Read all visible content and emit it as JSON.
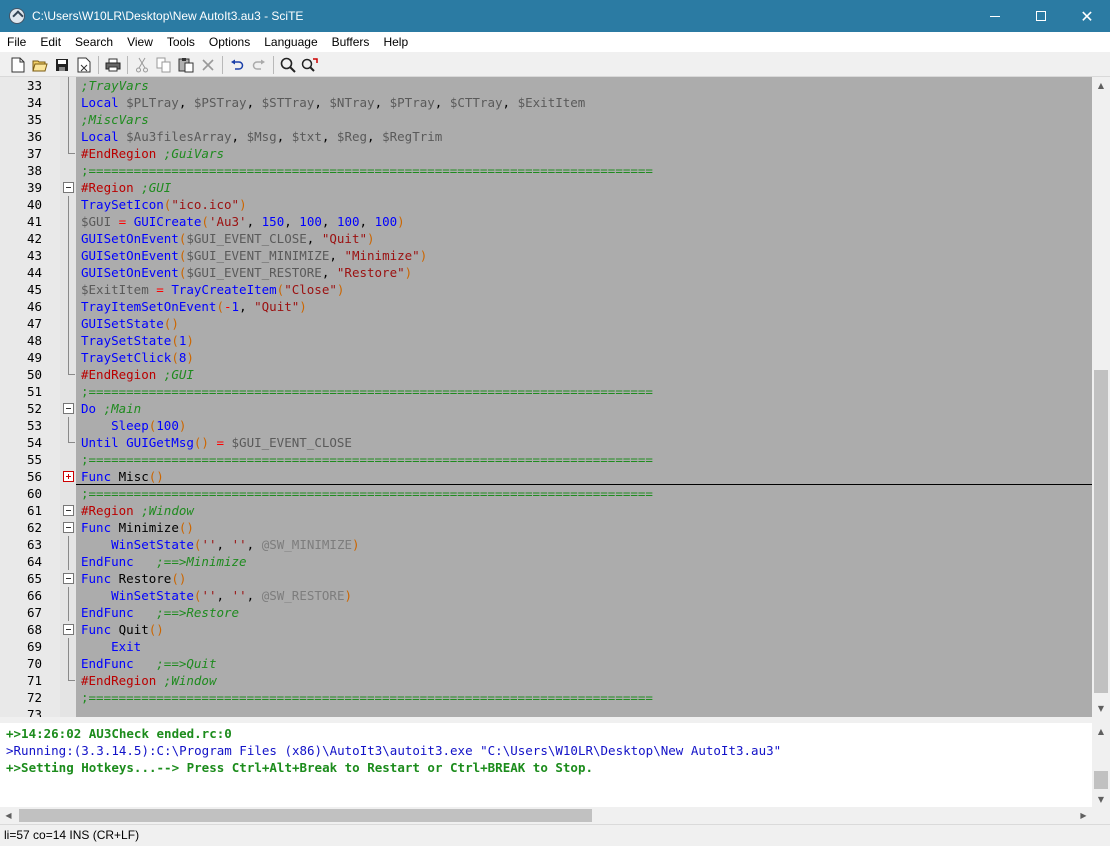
{
  "window": {
    "title": "C:\\Users\\W10LR\\Desktop\\New AutoIt3.au3 - SciTE",
    "minimize": "",
    "maximize": "",
    "close": "✕"
  },
  "menu": [
    "File",
    "Edit",
    "Search",
    "View",
    "Tools",
    "Options",
    "Language",
    "Buffers",
    "Help"
  ],
  "toolbar": {
    "icons": [
      "new-file-icon",
      "open-folder-icon",
      "save-icon",
      "close-file-icon",
      "print-icon",
      "cut-icon",
      "copy-icon",
      "paste-icon",
      "delete-icon",
      "undo-icon",
      "redo-icon",
      "find-icon",
      "find-replace-icon"
    ]
  },
  "editor": {
    "lines": [
      {
        "n": "33",
        "fold": "line",
        "tokens": [
          [
            "com",
            ";TrayVars"
          ]
        ]
      },
      {
        "n": "34",
        "fold": "line",
        "tokens": [
          [
            "kw",
            "Local "
          ],
          [
            "var",
            "$PLTray"
          ],
          [
            "txt",
            ", "
          ],
          [
            "var",
            "$PSTray"
          ],
          [
            "txt",
            ", "
          ],
          [
            "var",
            "$STTray"
          ],
          [
            "txt",
            ", "
          ],
          [
            "var",
            "$NTray"
          ],
          [
            "txt",
            ", "
          ],
          [
            "var",
            "$PTray"
          ],
          [
            "txt",
            ", "
          ],
          [
            "var",
            "$CTTray"
          ],
          [
            "txt",
            ", "
          ],
          [
            "var",
            "$ExitItem"
          ]
        ]
      },
      {
        "n": "35",
        "fold": "line",
        "tokens": [
          [
            "com",
            ";MiscVars"
          ]
        ]
      },
      {
        "n": "36",
        "fold": "line",
        "tokens": [
          [
            "kw",
            "Local "
          ],
          [
            "var",
            "$Au3filesArray"
          ],
          [
            "txt",
            ", "
          ],
          [
            "var",
            "$Msg"
          ],
          [
            "txt",
            ", "
          ],
          [
            "var",
            "$txt"
          ],
          [
            "txt",
            ", "
          ],
          [
            "var",
            "$Reg"
          ],
          [
            "txt",
            ", "
          ],
          [
            "var",
            "$RegTrim"
          ]
        ]
      },
      {
        "n": "37",
        "fold": "end",
        "tokens": [
          [
            "pre",
            "#EndRegion "
          ],
          [
            "com",
            ";GuiVars"
          ]
        ]
      },
      {
        "n": "38",
        "fold": "none",
        "tokens": [
          [
            "sep",
            ";==========================================================================="
          ]
        ]
      },
      {
        "n": "39",
        "fold": "minus",
        "tokens": [
          [
            "pre",
            "#Region "
          ],
          [
            "com",
            ";GUI"
          ]
        ]
      },
      {
        "n": "40",
        "fold": "line",
        "tokens": [
          [
            "fn",
            "TraySetIcon"
          ],
          [
            "par",
            "("
          ],
          [
            "str",
            "\"ico.ico\""
          ],
          [
            "par",
            ")"
          ]
        ]
      },
      {
        "n": "41",
        "fold": "line",
        "tokens": [
          [
            "var",
            "$GUI"
          ],
          [
            "op",
            " = "
          ],
          [
            "fn",
            "GUICreate"
          ],
          [
            "par",
            "("
          ],
          [
            "str",
            "'Au3'"
          ],
          [
            "txt",
            ", "
          ],
          [
            "num",
            "150"
          ],
          [
            "txt",
            ", "
          ],
          [
            "num",
            "100"
          ],
          [
            "txt",
            ", "
          ],
          [
            "num",
            "100"
          ],
          [
            "txt",
            ", "
          ],
          [
            "num",
            "100"
          ],
          [
            "par",
            ")"
          ]
        ]
      },
      {
        "n": "42",
        "fold": "line",
        "tokens": [
          [
            "fn",
            "GUISetOnEvent"
          ],
          [
            "par",
            "("
          ],
          [
            "var",
            "$GUI_EVENT_CLOSE"
          ],
          [
            "txt",
            ", "
          ],
          [
            "str",
            "\"Quit\""
          ],
          [
            "par",
            ")"
          ]
        ]
      },
      {
        "n": "43",
        "fold": "line",
        "tokens": [
          [
            "fn",
            "GUISetOnEvent"
          ],
          [
            "par",
            "("
          ],
          [
            "var",
            "$GUI_EVENT_MINIMIZE"
          ],
          [
            "txt",
            ", "
          ],
          [
            "str",
            "\"Minimize\""
          ],
          [
            "par",
            ")"
          ]
        ]
      },
      {
        "n": "44",
        "fold": "line",
        "tokens": [
          [
            "fn",
            "GUISetOnEvent"
          ],
          [
            "par",
            "("
          ],
          [
            "var",
            "$GUI_EVENT_RESTORE"
          ],
          [
            "txt",
            ", "
          ],
          [
            "str",
            "\"Restore\""
          ],
          [
            "par",
            ")"
          ]
        ]
      },
      {
        "n": "45",
        "fold": "line",
        "tokens": [
          [
            "var",
            "$ExitItem"
          ],
          [
            "op",
            " = "
          ],
          [
            "fn",
            "TrayCreateItem"
          ],
          [
            "par",
            "("
          ],
          [
            "str",
            "\"Close\""
          ],
          [
            "par",
            ")"
          ]
        ]
      },
      {
        "n": "46",
        "fold": "line",
        "tokens": [
          [
            "fn",
            "TrayItemSetOnEvent"
          ],
          [
            "par",
            "("
          ],
          [
            "op",
            "-"
          ],
          [
            "num",
            "1"
          ],
          [
            "txt",
            ", "
          ],
          [
            "str",
            "\"Quit\""
          ],
          [
            "par",
            ")"
          ]
        ]
      },
      {
        "n": "47",
        "fold": "line",
        "tokens": [
          [
            "fn",
            "GUISetState"
          ],
          [
            "par",
            "()"
          ]
        ]
      },
      {
        "n": "48",
        "fold": "line",
        "tokens": [
          [
            "fn",
            "TraySetState"
          ],
          [
            "par",
            "("
          ],
          [
            "num",
            "1"
          ],
          [
            "par",
            ")"
          ]
        ]
      },
      {
        "n": "49",
        "fold": "line",
        "tokens": [
          [
            "fn",
            "TraySetClick"
          ],
          [
            "par",
            "("
          ],
          [
            "num",
            "8"
          ],
          [
            "par",
            ")"
          ]
        ]
      },
      {
        "n": "50",
        "fold": "end",
        "tokens": [
          [
            "pre",
            "#EndRegion "
          ],
          [
            "com",
            ";GUI"
          ]
        ]
      },
      {
        "n": "51",
        "fold": "none",
        "tokens": [
          [
            "sep",
            ";==========================================================================="
          ]
        ]
      },
      {
        "n": "52",
        "fold": "minus",
        "tokens": [
          [
            "kw",
            "Do "
          ],
          [
            "com",
            ";Main"
          ]
        ]
      },
      {
        "n": "53",
        "fold": "line",
        "tokens": [
          [
            "txt",
            "    "
          ],
          [
            "fn",
            "Sleep"
          ],
          [
            "par",
            "("
          ],
          [
            "num",
            "100"
          ],
          [
            "par",
            ")"
          ]
        ]
      },
      {
        "n": "54",
        "fold": "end",
        "tokens": [
          [
            "kw",
            "Until "
          ],
          [
            "fn",
            "GUIGetMsg"
          ],
          [
            "par",
            "()"
          ],
          [
            "op",
            " = "
          ],
          [
            "var",
            "$GUI_EVENT_CLOSE"
          ]
        ]
      },
      {
        "n": "55",
        "fold": "none",
        "tokens": [
          [
            "sep",
            ";==========================================================================="
          ]
        ]
      },
      {
        "n": "56",
        "fold": "plus",
        "tokens": [
          [
            "kw",
            "Func "
          ],
          [
            "txt",
            "Misc"
          ],
          [
            "par",
            "()"
          ]
        ]
      },
      {
        "n": "60",
        "fold": "none",
        "tokens": [
          [
            "sep",
            ";==========================================================================="
          ]
        ]
      },
      {
        "n": "61",
        "fold": "minus",
        "tokens": [
          [
            "pre",
            "#Region "
          ],
          [
            "com",
            ";Window"
          ]
        ]
      },
      {
        "n": "62",
        "fold": "minus",
        "tokens": [
          [
            "kw",
            "Func "
          ],
          [
            "txt",
            "Minimize"
          ],
          [
            "par",
            "()"
          ]
        ]
      },
      {
        "n": "63",
        "fold": "line",
        "tokens": [
          [
            "txt",
            "    "
          ],
          [
            "fn",
            "WinSetState"
          ],
          [
            "par",
            "("
          ],
          [
            "str",
            "''"
          ],
          [
            "txt",
            ", "
          ],
          [
            "str",
            "''"
          ],
          [
            "txt",
            ", "
          ],
          [
            "mac",
            "@SW_MINIMIZE"
          ],
          [
            "par",
            ")"
          ]
        ]
      },
      {
        "n": "64",
        "fold": "line",
        "tokens": [
          [
            "kw",
            "EndFunc"
          ],
          [
            "txt",
            "   "
          ],
          [
            "com",
            ";==>Minimize"
          ]
        ]
      },
      {
        "n": "65",
        "fold": "minus",
        "tokens": [
          [
            "kw",
            "Func "
          ],
          [
            "txt",
            "Restore"
          ],
          [
            "par",
            "()"
          ]
        ]
      },
      {
        "n": "66",
        "fold": "line",
        "tokens": [
          [
            "txt",
            "    "
          ],
          [
            "fn",
            "WinSetState"
          ],
          [
            "par",
            "("
          ],
          [
            "str",
            "''"
          ],
          [
            "txt",
            ", "
          ],
          [
            "str",
            "''"
          ],
          [
            "txt",
            ", "
          ],
          [
            "mac",
            "@SW_RESTORE"
          ],
          [
            "par",
            ")"
          ]
        ]
      },
      {
        "n": "67",
        "fold": "line",
        "tokens": [
          [
            "kw",
            "EndFunc"
          ],
          [
            "txt",
            "   "
          ],
          [
            "com",
            ";==>Restore"
          ]
        ]
      },
      {
        "n": "68",
        "fold": "minus",
        "tokens": [
          [
            "kw",
            "Func "
          ],
          [
            "txt",
            "Quit"
          ],
          [
            "par",
            "()"
          ]
        ]
      },
      {
        "n": "69",
        "fold": "line",
        "tokens": [
          [
            "txt",
            "    "
          ],
          [
            "kw",
            "Exit"
          ]
        ]
      },
      {
        "n": "70",
        "fold": "line",
        "tokens": [
          [
            "kw",
            "EndFunc"
          ],
          [
            "txt",
            "   "
          ],
          [
            "com",
            ";==>Quit"
          ]
        ]
      },
      {
        "n": "71",
        "fold": "end",
        "tokens": [
          [
            "pre",
            "#EndRegion "
          ],
          [
            "com",
            ";Window"
          ]
        ]
      },
      {
        "n": "72",
        "fold": "none",
        "tokens": [
          [
            "sep",
            ";==========================================================================="
          ]
        ]
      },
      {
        "n": "73",
        "fold": "none",
        "tokens": []
      }
    ]
  },
  "output": {
    "lines": [
      {
        "cls": "green",
        "text": "+>14:26:02 AU3Check ended.rc:0"
      },
      {
        "cls": "blue",
        "text": ">Running:(3.3.14.5):C:\\Program Files (x86)\\AutoIt3\\autoit3.exe \"C:\\Users\\W10LR\\Desktop\\New AutoIt3.au3\""
      },
      {
        "cls": "green",
        "text": "+>Setting Hotkeys...--> Press Ctrl+Alt+Break to Restart or Ctrl+BREAK to Stop."
      }
    ]
  },
  "statusbar": {
    "text": "li=57 co=14 INS (CR+LF)"
  }
}
